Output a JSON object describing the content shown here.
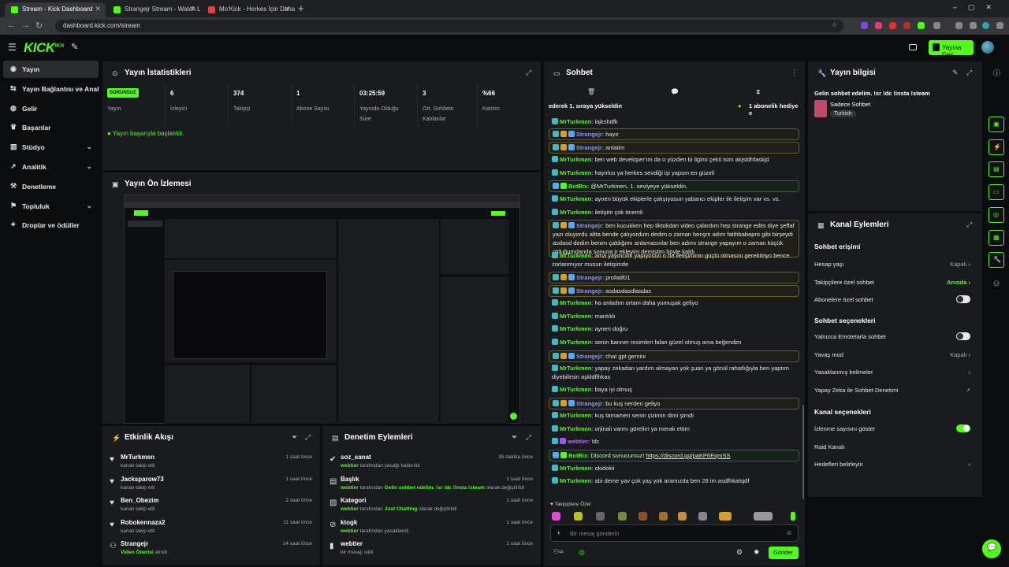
{
  "browser": {
    "tabs": [
      {
        "label": "Stream - Kick Dashboard",
        "color": "#53fc18"
      },
      {
        "label": "Strangejr Stream - Watch Live o",
        "color": "#53fc18"
      },
      {
        "label": "Mo'Kick - Herkes İçin Daha İyi E",
        "color": "#d44"
      }
    ],
    "url": "dashboard.kick.com/stream"
  },
  "header": {
    "logo": "KICK",
    "logo_sup": "BETA",
    "go_live": "Yayına Geç"
  },
  "sidebar": {
    "items": [
      {
        "label": "Yayın",
        "icon": "broadcast-icon",
        "active": true
      },
      {
        "label": "Yayın Bağlantısı ve Anahtar",
        "icon": "link-icon"
      },
      {
        "label": "Gelir",
        "icon": "money-icon"
      },
      {
        "label": "Başarılar",
        "icon": "trophy-icon"
      },
      {
        "label": "Stüdyo",
        "icon": "studio-icon",
        "chev": true
      },
      {
        "label": "Analitik",
        "icon": "analytics-icon",
        "chev": true
      },
      {
        "label": "Denetleme",
        "icon": "moderation-icon"
      },
      {
        "label": "Topluluk",
        "icon": "community-icon",
        "chev": true
      },
      {
        "label": "Droplar ve ödüller",
        "icon": "gift-icon"
      }
    ]
  },
  "stats": {
    "title": "Yayın İstatistikleri",
    "badge": "SORUNSUZ",
    "items": [
      {
        "value": "",
        "label": "Yayın"
      },
      {
        "value": "6",
        "label": "İzleyici"
      },
      {
        "value": "374",
        "label": "Takipçi"
      },
      {
        "value": "1",
        "label": "Abone Sayısı"
      },
      {
        "value": "03:25:59",
        "label": "Yayında Olduğu\nSüre"
      },
      {
        "value": "3",
        "label": "Ort. Sohbete\nKatılanlar"
      },
      {
        "value": "%66",
        "label": "Katılım"
      }
    ],
    "success": "Yayın başarıyla başlatıldı."
  },
  "preview": {
    "title": "Yayın Ön İzlemesi"
  },
  "feed": {
    "title": "Etkinlik Akışı",
    "items": [
      {
        "name": "MrTurkmen",
        "sub": "kanalı takip etti",
        "time": "1 saat önce",
        "icon": "heart-icon"
      },
      {
        "name": "Jacksparow73",
        "sub": "kanalı takip etti",
        "time": "1 saat önce",
        "icon": "heart-icon"
      },
      {
        "name": "Ben_Obezim",
        "sub": "kanalı takip etti",
        "time": "2 saat önce",
        "icon": "heart-icon"
      },
      {
        "name": "Robokennaza2",
        "sub": "kanalı takip etti",
        "time": "11 saat önce",
        "icon": "heart-icon"
      },
      {
        "name": "Strangejr",
        "sub_bold": "Video Önerisi",
        "sub": "alındı",
        "time": "14 saat önce",
        "icon": "video-icon"
      }
    ]
  },
  "modlog": {
    "title": "Denetim Eylemleri",
    "items": [
      {
        "name": "soz_sanat",
        "actor": "webtier",
        "rest": "tarafından yasağı kaldırıldı",
        "time": "35 dakika önce",
        "icon": "unban-icon"
      },
      {
        "name": "Başlık",
        "actor": "webtier",
        "mid": "tarafından",
        "bold2": "Gelin sohbet edelim. !sr !dc !insta !steam",
        "rest": "olarak değiştirildi",
        "time": "1 saat önce",
        "icon": "title-icon"
      },
      {
        "name": "Kategori",
        "actor": "webtier",
        "mid": "tarafından",
        "bold2": "Just Chatting",
        "rest": "olarak değiştirildi",
        "time": "1 saat önce",
        "icon": "category-icon"
      },
      {
        "name": "ktogk",
        "actor": "webtier",
        "rest": "tarafından yasaklandı",
        "time": "1 saat önce",
        "icon": "ban-icon"
      },
      {
        "name": "webtier",
        "actor": "",
        "rest": "bir mesajı sildi",
        "time": "1 saat önce",
        "icon": "trash-icon"
      }
    ]
  },
  "chat": {
    "title": "Sohbet",
    "pinned": "ederek 1. sıraya yükseldin",
    "pinned2": "1 abonelik hediye e",
    "messages": [
      {
        "u": "MrTurkmen",
        "c": "green",
        "b": "k",
        "t": "lajkshdfk"
      },
      {
        "u": "Strangejr",
        "c": "blue",
        "b": "kgs",
        "t": "hayır",
        "hl": true
      },
      {
        "u": "Strangejr",
        "c": "blue",
        "b": "kgs",
        "t": "anlatim",
        "hl": true
      },
      {
        "u": "MrTurkmen",
        "c": "green",
        "b": "k",
        "t": "ben web developer'ım da o yüzden bi ilgimi çekti isim akjsldhfaskjd"
      },
      {
        "u": "MrTurkmen",
        "c": "green",
        "b": "k",
        "t": "hayırlısı ya herkes sevdiği işi yapsın en güzeli"
      },
      {
        "u": "BotRix",
        "c": "green",
        "b": "sc",
        "t": "@MrTurkmen, 1. seviyeye yükseldin.",
        "bot": true
      },
      {
        "u": "MrTurkmen",
        "c": "green",
        "b": "k",
        "t": "aynen büyük ekiplerle çalışıyosun yabancı ekipler ile iletişim var vs. vs."
      },
      {
        "u": "MrTurkmen",
        "c": "green",
        "b": "k",
        "t": "iletişim çok önemli"
      },
      {
        "u": "Strangejr",
        "c": "blue",
        "b": "kgs",
        "t": "ben kucukken hep tiktokdan video çalardım hep strange edits diye şeffaf yazı oluyordu altta bende çalıyordum dedim o zaman benşm adım fatihbabapro gibi birşeydi asdasd dedim benim çaldığımı anlamasınlar ben adımı strange yapayım o zaman küçük olduğumdanda sonuna jr ekleyim demiştim böyle kaldı",
        "hl": true
      },
      {
        "u": "MrTurkmen",
        "c": "green",
        "b": "k",
        "t": "ama yayıncılık yapıyosun o da iletişiminin güçlü olmasını gerektiriyo bence. zorlanmıyor musun iletişimde"
      },
      {
        "u": "Strangejr",
        "c": "blue",
        "b": "kgs",
        "t": "profatif01",
        "hl": true
      },
      {
        "u": "Strangejr",
        "c": "blue",
        "b": "kgs",
        "t": "asdasdasdlasdas",
        "hl": true
      },
      {
        "u": "MrTurkmen",
        "c": "green",
        "b": "k",
        "t": "ha anladım ortam daha yumuşak geliyo"
      },
      {
        "u": "MrTurkmen",
        "c": "green",
        "b": "k",
        "t": "mantıklı"
      },
      {
        "u": "MrTurkmen",
        "c": "green",
        "b": "k",
        "t": "aynen doğru"
      },
      {
        "u": "MrTurkmen",
        "c": "green",
        "b": "k",
        "t": "senin banner resimleri falan güzel olmuş ama beğendim"
      },
      {
        "u": "Strangejr",
        "c": "blue",
        "b": "kgs",
        "t": "chat gpt gemini",
        "hl": true
      },
      {
        "u": "MrTurkmen",
        "c": "green",
        "b": "k",
        "t": "yapay zekadan yardım almayan yok şuan ya gönül rahatlığıyla ben yaptım diyebilirsin aşkldflhkas"
      },
      {
        "u": "MrTurkmen",
        "c": "green",
        "b": "k",
        "t": "baya iyi olmuş"
      },
      {
        "u": "Strangejr",
        "c": "blue",
        "b": "kgs",
        "t": "bu kuş nerden geliyo",
        "hl": true
      },
      {
        "u": "MrTurkmen",
        "c": "green",
        "b": "k",
        "t": "kuş tamamen senin çizimin dimi şimdi"
      },
      {
        "u": "MrTurkmen",
        "c": "green",
        "b": "k",
        "t": "orjinali varmı görelim ya merak ettim"
      },
      {
        "u": "webtier",
        "c": "purple",
        "b": "kp",
        "t": "!dc"
      },
      {
        "u": "BotRix",
        "c": "green",
        "b": "sc",
        "t": "Discord sunucumuz! ",
        "link": "https://discord.gg/paKP6EqmSS",
        "bot": true
      },
      {
        "u": "MrTurkmen",
        "c": "green",
        "b": "k",
        "t": "okidokii"
      },
      {
        "u": "MrTurkmen",
        "c": "green",
        "b": "k",
        "t": "abi deme yav çok yaş yok aramızda ben 28 im asdfhkalsjdf"
      }
    ],
    "followers_only": "Takipçilere Özel",
    "placeholder": "Bir mesaj gönderin",
    "send": "Gönder"
  },
  "info": {
    "title": "Yayın bilgisi",
    "stream_title": "Gelin sohbet edelim. !sr !dc !insta !steam",
    "category": "Sadece Sohbet",
    "tag": "Turkish"
  },
  "actions": {
    "title": "Kanal Eylemleri",
    "sec1": "Sohbet erişimi",
    "rows1": [
      {
        "label": "Hesap yaşı",
        "value": "Kapalı",
        "kind": "chev"
      },
      {
        "label": "Takipçilere özel sohbet",
        "value": "Anında",
        "kind": "chev",
        "on": true
      },
      {
        "label": "Abonelere özel sohbet",
        "kind": "toggle",
        "state": false
      }
    ],
    "sec2": "Sohbet seçenekleri",
    "rows2": [
      {
        "label": "Yalnızca Emotelarla sohbet",
        "kind": "toggle",
        "state": false
      },
      {
        "label": "Yavaş mod",
        "value": "Kapalı",
        "kind": "chev"
      },
      {
        "label": "Yasaklanmış kelimeler",
        "kind": "chev"
      },
      {
        "label": "Yapay Zeka ile Sohbet Denetimi",
        "kind": "ext"
      }
    ],
    "sec3": "Kanal seçenekleri",
    "rows3": [
      {
        "label": "İzlenme sayısını göster",
        "kind": "toggle",
        "state": true
      },
      {
        "label": "Raid Kanalı",
        "kind": "none"
      },
      {
        "label": "Hedefleri belirleyin",
        "kind": "chev"
      }
    ]
  }
}
